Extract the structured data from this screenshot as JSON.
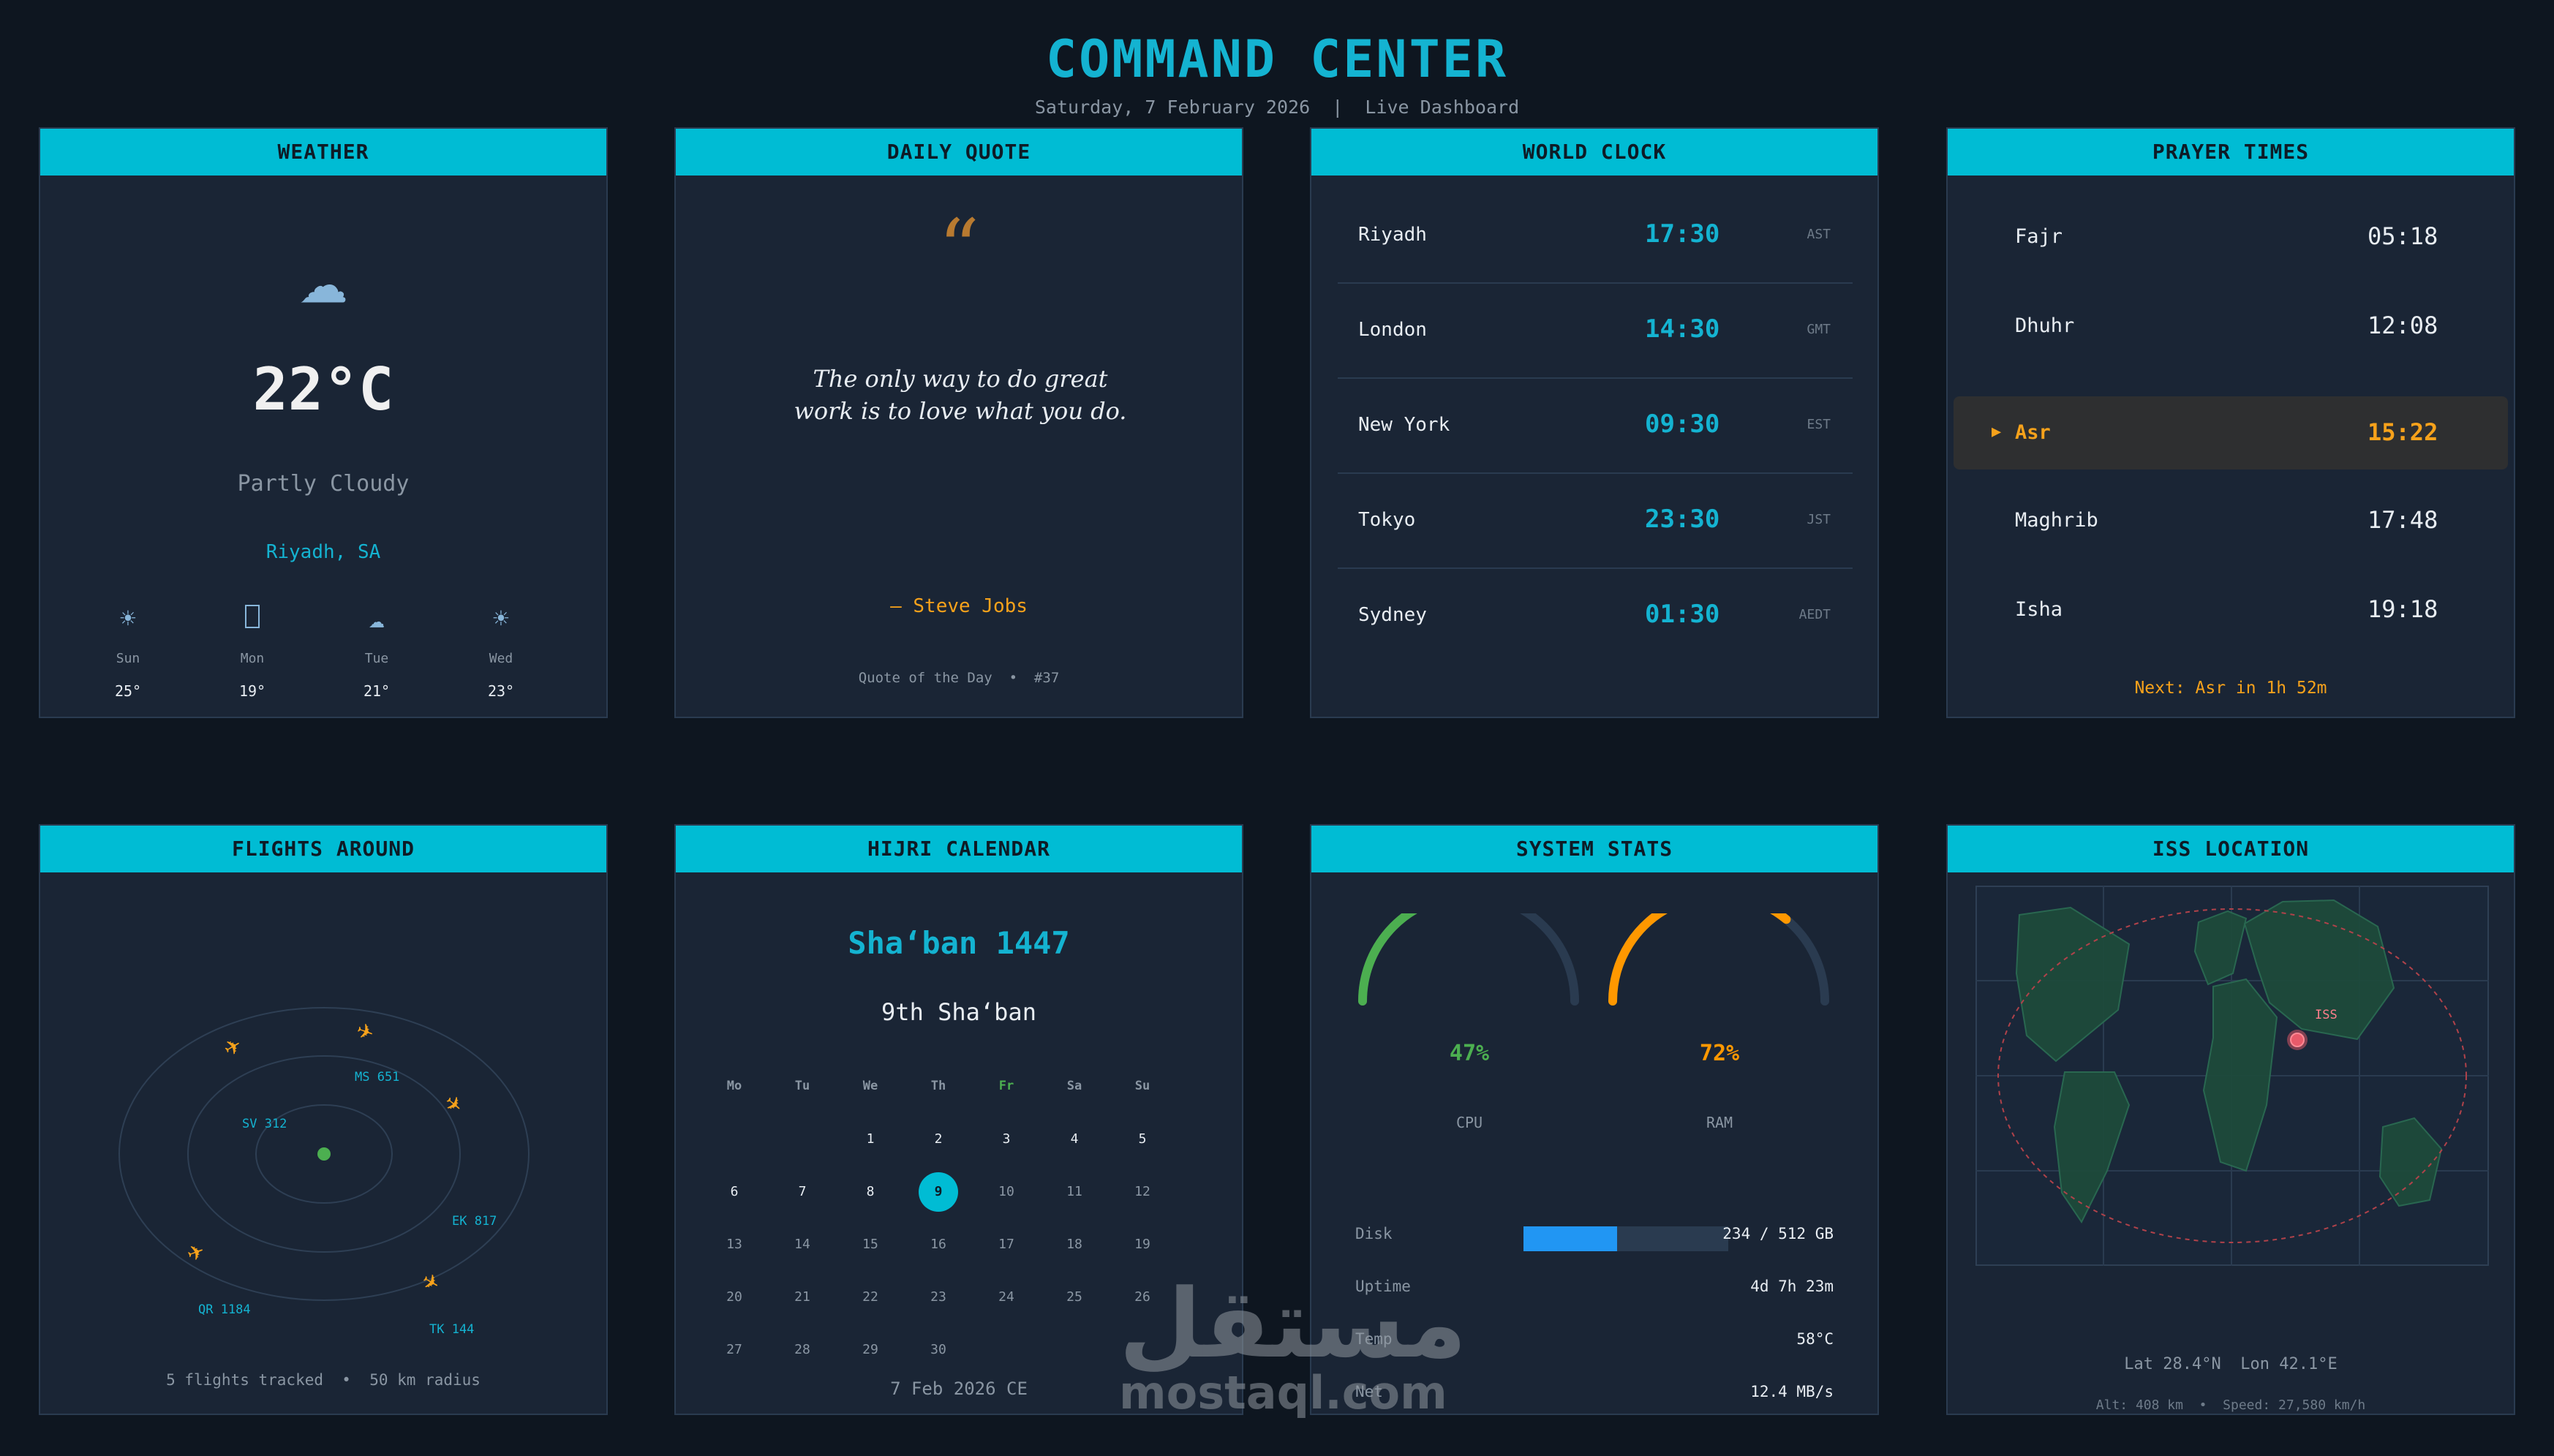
{
  "header": {
    "title": "COMMAND CENTER",
    "subtitle": "Saturday, 7 February 2026  |  Live Dashboard"
  },
  "colors": {
    "accent": "#00bcd4",
    "warning": "#f7a21b",
    "success": "#4caf50",
    "info": "#2196f3",
    "panel": "#1a2535",
    "background": "#0e1620"
  },
  "weather": {
    "heading": "WEATHER",
    "icon": "cloud-icon",
    "temperature": "22°C",
    "condition": "Partly Cloudy",
    "location": "Riyadh, SA",
    "forecast": [
      {
        "day": "Sun",
        "temp": "25°",
        "icon": "sun-icon"
      },
      {
        "day": "Mon",
        "temp": "19°",
        "icon": "unknown-glyph-icon"
      },
      {
        "day": "Tue",
        "temp": "21°",
        "icon": "cloud-icon"
      },
      {
        "day": "Wed",
        "temp": "23°",
        "icon": "sun-icon"
      }
    ]
  },
  "quote": {
    "heading": "DAILY QUOTE",
    "mark": "“",
    "text": "The only way to do great work is to love what you do.",
    "author": "— Steve Jobs",
    "footer": "Quote of the Day  •  #37"
  },
  "world_clock": {
    "heading": "WORLD CLOCK",
    "cities": [
      {
        "city": "Riyadh",
        "time": "17:30",
        "tz": "AST"
      },
      {
        "city": "London",
        "time": "14:30",
        "tz": "GMT"
      },
      {
        "city": "New York",
        "time": "09:30",
        "tz": "EST"
      },
      {
        "city": "Tokyo",
        "time": "23:30",
        "tz": "JST"
      },
      {
        "city": "Sydney",
        "time": "01:30",
        "tz": "AEDT"
      }
    ]
  },
  "prayer": {
    "heading": "PRAYER TIMES",
    "marker": "▶",
    "times": [
      {
        "name": "Fajr",
        "time": "05:18"
      },
      {
        "name": "Dhuhr",
        "time": "12:08"
      },
      {
        "name": "Asr",
        "time": "15:22",
        "active": true
      },
      {
        "name": "Maghrib",
        "time": "17:48"
      },
      {
        "name": "Isha",
        "time": "19:18"
      }
    ],
    "next": "Next: Asr in 1h 52m"
  },
  "flights": {
    "heading": "FLIGHTS AROUND",
    "labels": [
      "MS 651",
      "SV 312",
      "EK 817",
      "QR 1184",
      "TK 144"
    ],
    "footer": "5 flights tracked  •  50 km radius"
  },
  "hijri": {
    "heading": "HIJRI CALENDAR",
    "month": "Sha‘ban 1447",
    "day": "9th Sha‘ban",
    "weekdays": [
      "Mo",
      "Tu",
      "We",
      "Th",
      "Fr",
      "Sa",
      "Su"
    ],
    "today": "9",
    "weeks": [
      [
        "",
        "",
        "1",
        "2",
        "3",
        "4",
        "5"
      ],
      [
        "6",
        "7",
        "8",
        "9",
        "10",
        "11",
        "12"
      ],
      [
        "13",
        "14",
        "15",
        "16",
        "17",
        "18",
        "19"
      ],
      [
        "20",
        "21",
        "22",
        "23",
        "24",
        "25",
        "26"
      ],
      [
        "27",
        "28",
        "29",
        "30",
        "",
        "",
        ""
      ]
    ],
    "gregorian": "7 Feb 2026 CE"
  },
  "system": {
    "heading": "SYSTEM STATS",
    "cpu": {
      "label": "CPU",
      "value": "47%",
      "percent": 47,
      "color": "#4caf50"
    },
    "ram": {
      "label": "RAM",
      "value": "72%",
      "percent": 72,
      "color": "#ff9800"
    },
    "disk": {
      "label": "Disk",
      "value": "234 / 512 GB",
      "fraction": 0.457
    },
    "uptime": {
      "label": "Uptime",
      "value": "4d 7h 23m"
    },
    "temp": {
      "label": "Temp",
      "value": "58°C"
    },
    "net": {
      "label": "Net",
      "value": "12.4 MB/s"
    }
  },
  "iss": {
    "heading": "ISS LOCATION",
    "marker_label": "ISS",
    "coords": "Lat 28.4°N  Lon 42.1°E",
    "footer": "Alt: 408 km  •  Speed: 27,580 km/h"
  },
  "watermark": {
    "arabic": "مستقل",
    "latin": "mostaql.com"
  }
}
